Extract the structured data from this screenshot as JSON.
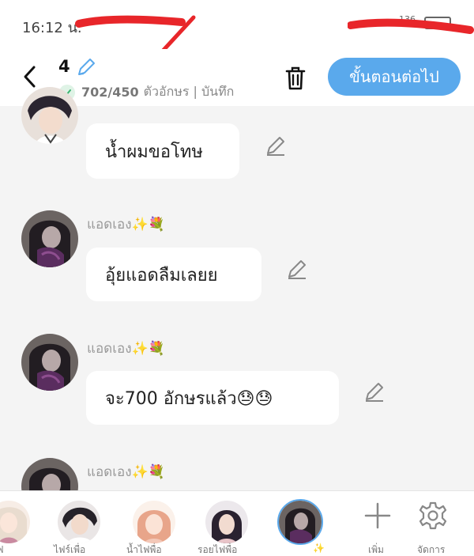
{
  "status_bar": {
    "time": "16:12 น.",
    "network": "136"
  },
  "header": {
    "episode_number": "4",
    "char_count": "702/450",
    "char_label": "ตัวอักษร | บันทึก",
    "next_button": "ขั้นตอนต่อไป"
  },
  "messages": [
    {
      "name": "",
      "text": "น้ำผมขอโทษ"
    },
    {
      "name": "แอดเอง✨💐",
      "text": "อุ้ยแอดลืมเลยย"
    },
    {
      "name": "แอดเอง✨💐",
      "text": "จะ700 อักษรแล้ว😓😓"
    },
    {
      "name": "แอดเอง✨💐",
      "text": ""
    }
  ],
  "bottom_bar": {
    "characters": [
      {
        "name": "ฟ"
      },
      {
        "name": "ไฟร์เพื่อ"
      },
      {
        "name": "น้ำไฟพื่อ"
      },
      {
        "name": "รอยไฟพื่อ"
      },
      {
        "name": "✨"
      }
    ],
    "add_label": "เพิ่ม",
    "manage_label": "จัดการ"
  },
  "colors": {
    "accent": "#5aa9ec",
    "check": "#3cb371",
    "scribble": "#e8262a"
  }
}
